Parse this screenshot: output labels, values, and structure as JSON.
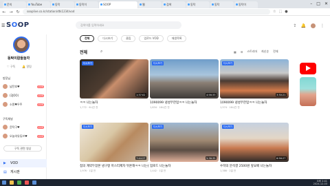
{
  "browser": {
    "tabs": [
      "문의",
      "YouTube",
      "동탁",
      "동탁이",
      "동탁이람",
      "웹",
      "검색",
      "SOOP",
      "동탁",
      "동탁",
      "동탁이"
    ],
    "active_tab": "SOOP",
    "url": "sooplive.co.kr/station/dtk1234/vod"
  },
  "header": {
    "logo_prefix": "S",
    "logo_o": "O",
    "logo_suffix": "OP",
    "search_placeholder": "검색어를 입력하세요"
  },
  "sidebar": {
    "channel_name": "동탁이람들놀자",
    "actions": [
      "구독",
      "알림"
    ],
    "section1_title": "방장님",
    "section1": [
      {
        "name": "남탄호♥",
        "badge": "LIVE"
      },
      {
        "name": "(2JOO)",
        "badge": "LIVE"
      },
      {
        "name": "소원♥우주",
        "badge": "LIVE"
      }
    ],
    "section2_title": "구독채널",
    "section2": [
      {
        "name": "윤탁구♥",
        "badge": "LIVE"
      },
      {
        "name": "오늘의유튜브♥",
        "badge": "LIVE"
      }
    ],
    "fan_button": "구독 관련 영상",
    "nav": [
      {
        "label": "VOD",
        "active": true
      },
      {
        "label": "게시판",
        "active": false
      }
    ]
  },
  "main": {
    "filters": [
      {
        "label": "전체",
        "on": true
      },
      {
        "label": "다시보기",
        "on": false
      },
      {
        "label": "클립",
        "on": false
      },
      {
        "label": "업로드 VOD",
        "on": false
      },
      {
        "label": "재생목록",
        "on": false
      }
    ],
    "section_title": "전체",
    "sort_options": [
      "스트리머",
      "최신순",
      "전체"
    ],
    "videos": [
      {
        "tag": "다시보기",
        "duration": "1:37:02",
        "title": "ㅋㅋ 나는놀자",
        "meta": "1,772 · 6시간 전"
      },
      {
        "tag": "다시보기",
        "duration": "4:56:33",
        "title": "1090099 냉성무한업ㅋㅋ 나는놀자",
        "meta": "1,834 · 16시간 전"
      },
      {
        "tag": "다시보기",
        "duration": "3:30:21",
        "title": "1090099 냉성무한업ㅋㅋ 나는놀자",
        "meta": "1,574 · 16시간 전"
      },
      {
        "tag": "다시보기",
        "duration": "7:44:27",
        "title": "점의 계약두었본 냉구항 마스터제자 뒤흔해ㅋㅋ 나는놀자",
        "meta": "1,976 · 1일 전"
      },
      {
        "tag": "다시보기",
        "duration": "5:38:35",
        "title": "업로드 나는놀자",
        "meta": "1,442 · 1일 전"
      },
      {
        "tag": "다시보기",
        "duration": "6:56:27",
        "title": "수학의 분석결 2500원 앞요배 나는놀자",
        "meta": "1,386 · 2일 전"
      }
    ]
  },
  "taskbar": {
    "time": "오후 2:41",
    "date": "2024-12-03"
  }
}
